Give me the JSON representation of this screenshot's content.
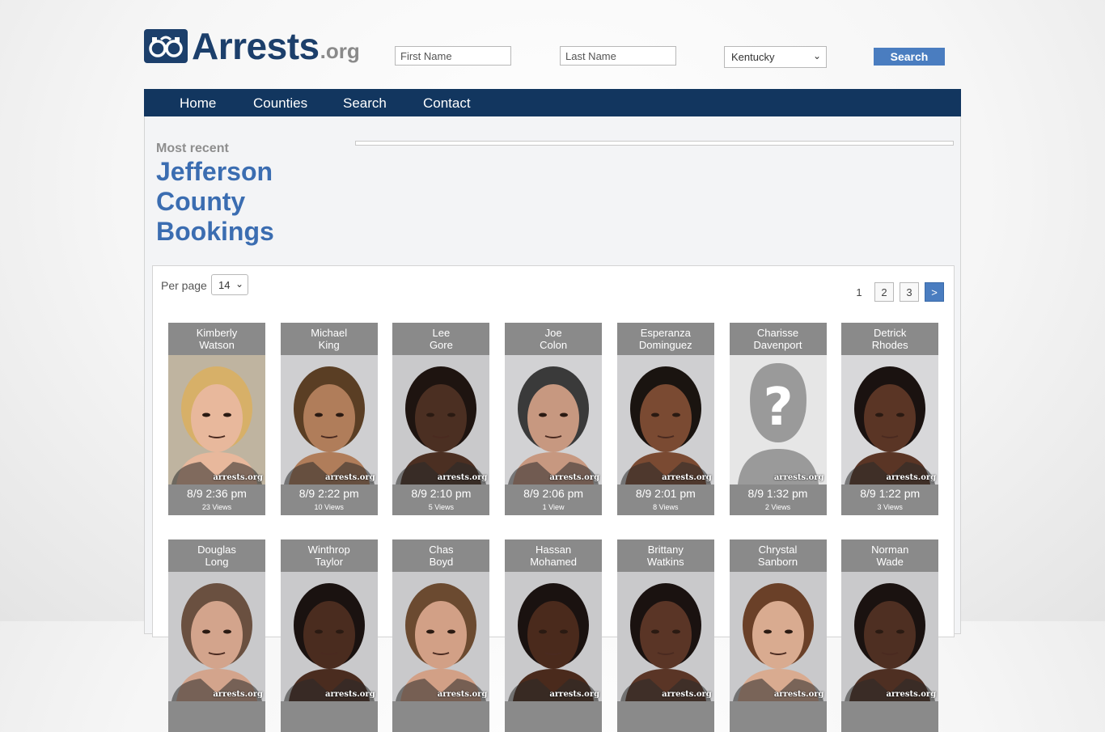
{
  "header": {
    "logo_text": "Arrests",
    "logo_tld": ".org",
    "first_name_placeholder": "First Name",
    "last_name_placeholder": "Last Name",
    "state_selected": "Kentucky",
    "search_label": "Search"
  },
  "nav": {
    "items": [
      {
        "label": "Home"
      },
      {
        "label": "Counties"
      },
      {
        "label": "Search"
      },
      {
        "label": "Contact"
      }
    ]
  },
  "main": {
    "eyebrow": "Most recent",
    "title_line1": "Jefferson",
    "title_line2": "County",
    "title_line3": "Bookings"
  },
  "results": {
    "per_page_label": "Per page",
    "per_page_value": "14",
    "pages": [
      "1",
      "2",
      "3",
      ">"
    ],
    "watermark": "arrests.org",
    "bookings": [
      {
        "first": "Kimberly",
        "last": "Watson",
        "time": "8/9 2:36 pm",
        "views": "23 Views",
        "bg": "#bfb4a0",
        "skin": "#e8b89c",
        "hair": "#d7b068"
      },
      {
        "first": "Michael",
        "last": "King",
        "time": "8/9 2:22 pm",
        "views": "10 Views",
        "bg": "#cfcfd1",
        "skin": "#b07d5a",
        "hair": "#5a3e24"
      },
      {
        "first": "Lee",
        "last": "Gore",
        "time": "8/9 2:10 pm",
        "views": "5 Views",
        "bg": "#c9c9cb",
        "skin": "#4b2f22",
        "hair": "#1e1410"
      },
      {
        "first": "Joe",
        "last": "Colon",
        "time": "8/9 2:06 pm",
        "views": "1 View",
        "bg": "#d2d2d4",
        "skin": "#c79880",
        "hair": "#3a3a3a"
      },
      {
        "first": "Esperanza",
        "last": "Dominguez",
        "time": "8/9 2:01 pm",
        "views": "8 Views",
        "bg": "#cfcfd1",
        "skin": "#7a4a32",
        "hair": "#1a1410"
      },
      {
        "first": "Charisse",
        "last": "Davenport",
        "time": "8/9 1:32 pm",
        "views": "2 Views",
        "bg": "#e6e6e6",
        "skin": "#9a9a9a",
        "hair": "#9a9a9a",
        "placeholder": "?"
      },
      {
        "first": "Detrick",
        "last": "Rhodes",
        "time": "8/9 1:22 pm",
        "views": "3 Views",
        "bg": "#d8d8da",
        "skin": "#5a3525",
        "hair": "#1a1210"
      },
      {
        "first": "Douglas",
        "last": "Long",
        "time": "",
        "views": "",
        "bg": "#c9c9cb",
        "skin": "#d3a48c",
        "hair": "#6a5040"
      },
      {
        "first": "Winthrop",
        "last": "Taylor",
        "time": "",
        "views": "",
        "bg": "#c9c9cb",
        "skin": "#4a2c1f",
        "hair": "#1a1210"
      },
      {
        "first": "Chas",
        "last": "Boyd",
        "time": "",
        "views": "",
        "bg": "#c9c9cb",
        "skin": "#d2a086",
        "hair": "#6b4a30"
      },
      {
        "first": "Hassan",
        "last": "Mohamed",
        "time": "",
        "views": "",
        "bg": "#c9c9cb",
        "skin": "#4a2a1c",
        "hair": "#1a1210"
      },
      {
        "first": "Brittany",
        "last": "Watkins",
        "time": "",
        "views": "",
        "bg": "#c9c9cb",
        "skin": "#5a3526",
        "hair": "#1a1210"
      },
      {
        "first": "Chrystal",
        "last": "Sanborn",
        "time": "",
        "views": "",
        "bg": "#c9c9cb",
        "skin": "#d9ab90",
        "hair": "#6a4028"
      },
      {
        "first": "Norman",
        "last": "Wade",
        "time": "",
        "views": "",
        "bg": "#c9c9cb",
        "skin": "#4e2f22",
        "hair": "#1a1210"
      }
    ]
  },
  "colors": {
    "brand_navy": "#1c3f6b",
    "nav_bg": "#12365f",
    "accent_blue": "#4a7dc0",
    "title_blue": "#3b6db1",
    "card_gray": "#8a8a8a"
  }
}
